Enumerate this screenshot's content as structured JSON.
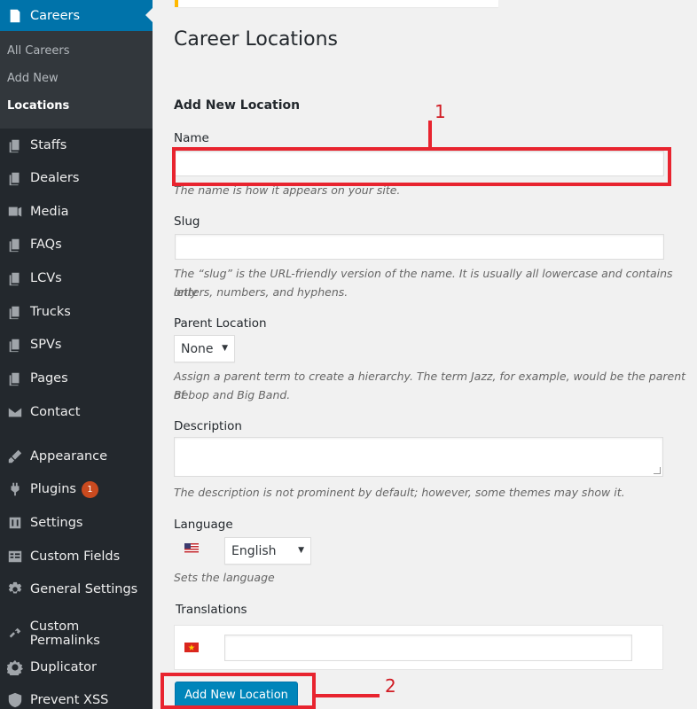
{
  "sidebar": {
    "current": {
      "label": "Careers",
      "icon": "pin-icon"
    },
    "submenu": [
      "All Careers",
      "Add New",
      "Locations"
    ],
    "items": [
      {
        "label": "Staffs",
        "icon": "pages-icon"
      },
      {
        "label": "Dealers",
        "icon": "pages-icon"
      },
      {
        "label": "Media",
        "icon": "media-icon"
      },
      {
        "label": "FAQs",
        "icon": "pages-icon"
      },
      {
        "label": "LCVs",
        "icon": "pages-icon"
      },
      {
        "label": "Trucks",
        "icon": "pages-icon"
      },
      {
        "label": "SPVs",
        "icon": "pages-icon"
      },
      {
        "label": "Pages",
        "icon": "pages-icon"
      },
      {
        "label": "Contact",
        "icon": "email-icon"
      },
      {
        "label": "Appearance",
        "icon": "brush-icon"
      },
      {
        "label": "Plugins",
        "icon": "plugin-icon",
        "badge": "1"
      },
      {
        "label": "Settings",
        "icon": "settings-icon"
      },
      {
        "label": "Custom Fields",
        "icon": "fields-icon"
      },
      {
        "label": "General Settings",
        "icon": "gear-icon"
      },
      {
        "label": "Custom Permalinks",
        "icon": "link-icon"
      },
      {
        "label": "Duplicator",
        "icon": "duplicator-icon"
      },
      {
        "label": "Prevent XSS",
        "icon": "shield-icon"
      }
    ]
  },
  "main": {
    "title": "Career Locations",
    "form_title": "Add New Location",
    "name_label": "Name",
    "name_value": "",
    "name_hint": "The name is how it appears on your site.",
    "slug_label": "Slug",
    "slug_value": "",
    "slug_hint_line1": "The “slug” is the URL-friendly version of the name. It is usually all lowercase and contains only",
    "slug_hint_line2": "letters, numbers, and hyphens.",
    "parent_label": "Parent Location",
    "parent_value": "None",
    "parent_hint_line1": "Assign a parent term to create a hierarchy. The term Jazz, for example, would be the parent of",
    "parent_hint_line2": "Bebop and Big Band.",
    "description_label": "Description",
    "description_value": "",
    "description_hint": "The description is not prominent by default; however, some themes may show it.",
    "language_label": "Language",
    "language_value": "English",
    "language_hint": "Sets the language",
    "translations_label": "Translations",
    "translation_value": "",
    "submit_label": "Add New Location"
  },
  "annotations": {
    "first": "1",
    "second": "2",
    "color": "#e8242f"
  },
  "colors": {
    "sidebar_bg": "#23282d",
    "accent": "#0073aa",
    "button": "#0085ba",
    "badge": "#ca4a1f"
  }
}
